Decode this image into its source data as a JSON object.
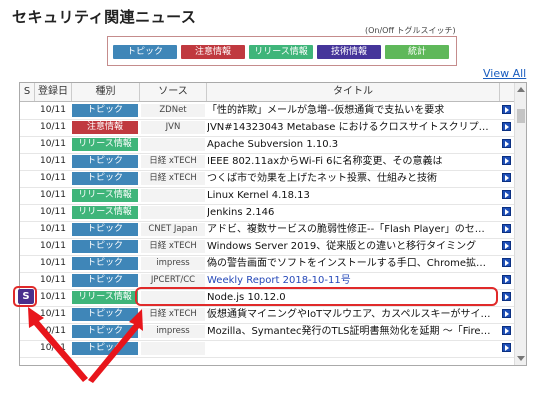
{
  "title": "セキュリティ関連ニュース",
  "toggle_hint": "(On/Off トグルスイッチ)",
  "filters": [
    {
      "label": "トピック",
      "color": "#3f86b8"
    },
    {
      "label": "注意情報",
      "color": "#c0393f"
    },
    {
      "label": "リリース情報",
      "color": "#3fb57a"
    },
    {
      "label": "技術情報",
      "color": "#45359a"
    },
    {
      "label": "統計",
      "color": "#5fb85a"
    }
  ],
  "view_all": "View All",
  "columns": {
    "s": "S",
    "date": "登録日",
    "category": "種別",
    "source": "ソース",
    "title": "タイトル"
  },
  "category_colors": {
    "トピック": "#3f86b8",
    "注意情報": "#c0393f",
    "リリース情報": "#3fb57a"
  },
  "rows": [
    {
      "date": "10/11",
      "category": "トピック",
      "source": "ZDNet",
      "title": "「性的詐欺」メールが急増--仮想通貨で支払いを要求"
    },
    {
      "date": "10/11",
      "category": "注意情報",
      "source": "JVN",
      "title": "JVN#14323043 Metabase におけるクロスサイトスクリプ…"
    },
    {
      "date": "10/11",
      "category": "リリース情報",
      "source": "",
      "title": "Apache Subversion 1.10.3"
    },
    {
      "date": "10/11",
      "category": "トピック",
      "source": "日経 xTECH",
      "title": "IEEE 802.11axからWi-Fi 6に名称変更、その意義は"
    },
    {
      "date": "10/11",
      "category": "トピック",
      "source": "日経 xTECH",
      "title": "つくば市で効果を上げたネット投票、仕組みと技術"
    },
    {
      "date": "10/11",
      "category": "リリース情報",
      "source": "",
      "title": "Linux Kernel 4.18.13"
    },
    {
      "date": "10/11",
      "category": "リリース情報",
      "source": "",
      "title": "Jenkins 2.146"
    },
    {
      "date": "10/11",
      "category": "トピック",
      "source": "CNET Japan",
      "title": "アドビ、複数サービスの脆弱性修正--「Flash Player」のセ…"
    },
    {
      "date": "10/11",
      "category": "トピック",
      "source": "日経 xTECH",
      "title": "Windows Server 2019、従来版との違いと移行タイミング"
    },
    {
      "date": "10/11",
      "category": "トピック",
      "source": "impress",
      "title": "偽の警告画面でソフトをインストールする手口、Chrome拡…"
    },
    {
      "date": "10/11",
      "category": "トピック",
      "source": "JPCERT/CC",
      "title": "Weekly Report 2018-10-11号",
      "highlight": true,
      "s": "S"
    },
    {
      "date": "10/11",
      "category": "リリース情報",
      "source": "",
      "title": "Node.js 10.12.0"
    },
    {
      "date": "10/11",
      "category": "トピック",
      "source": "日経 xTECH",
      "title": "仮想通貨マイニングやIoTマルウエア、カスペルスキーがサイ…"
    },
    {
      "date": "10/11",
      "category": "トピック",
      "source": "impress",
      "title": "Mozilla、Symantec発行のTLS証明書無効化を延期 ～「Fire…"
    },
    {
      "date": "10/11",
      "category": "トピック",
      "source": "",
      "title": ""
    }
  ]
}
